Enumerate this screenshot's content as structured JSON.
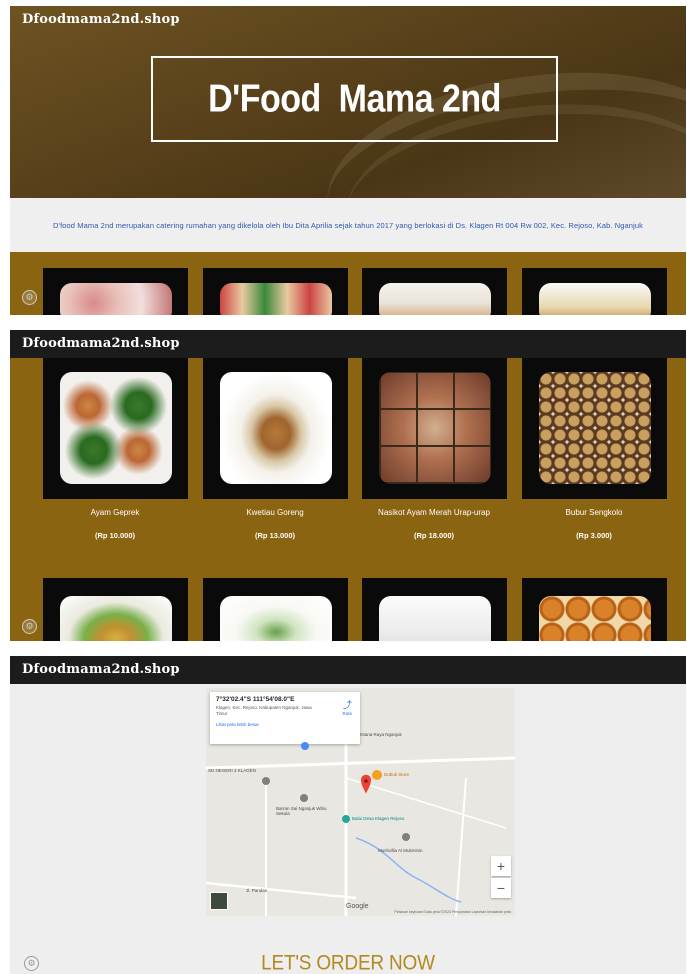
{
  "site_name": "Dfoodmama2nd.shop",
  "hero": {
    "title": "D'Food  Mama 2nd"
  },
  "about": {
    "text": "D'food Mama 2nd merupakan catering rumahan yang dikelola oleh Ibu Dita Aprilia sejak tahun 2017 yang berlokasi di Ds. Klagen Rt 004 Rw 002, Kec. Rejoso, Kab. Nganjuk"
  },
  "menu": {
    "items": [
      {
        "name": "Ayam Geprek",
        "price": "(Rp 10.000)"
      },
      {
        "name": "Kwetiau Goreng",
        "price": "(Rp 13.000)"
      },
      {
        "name": "Nasikot Ayam Merah Urap-urap",
        "price": "(Rp 18.000)"
      },
      {
        "name": "Bubur Sengkolo",
        "price": "(Rp 3.000)"
      }
    ]
  },
  "map": {
    "coordinates": "7°32'02.4\"S 111°54'08.0\"E",
    "address": "Klagen, Kec. Rejoso, Kabupaten Nganjuk, Jawa Timur",
    "route_label": "Rute",
    "larger_map_link": "Lihat peta lebih besar",
    "labels": {
      "school": "SD NEGERI 3 KLAGEN",
      "mosque_area": "Istana Raya Nganjuk",
      "shop": "Dubuk Store",
      "dealer": "Barran Sai Nganjuk Wibu Sekula",
      "village_hall": "Balai Desa Klagen Rejoso",
      "musholla": "Mushollla Al Mukminin",
      "road": "Jl. Pandan"
    },
    "zoom_in": "+",
    "zoom_out": "−",
    "google": "Google",
    "footer": "Pintasan keyboard   Data peta ©2023   Persyaratan   Laporkan kesalahan peta"
  },
  "order": {
    "title": "LET'S ORDER NOW"
  },
  "colors": {
    "hero_brown": "#57401a",
    "menu_gold": "#8a6410",
    "order_gold": "#b38a1f",
    "topbar": "#1d1c1c"
  }
}
